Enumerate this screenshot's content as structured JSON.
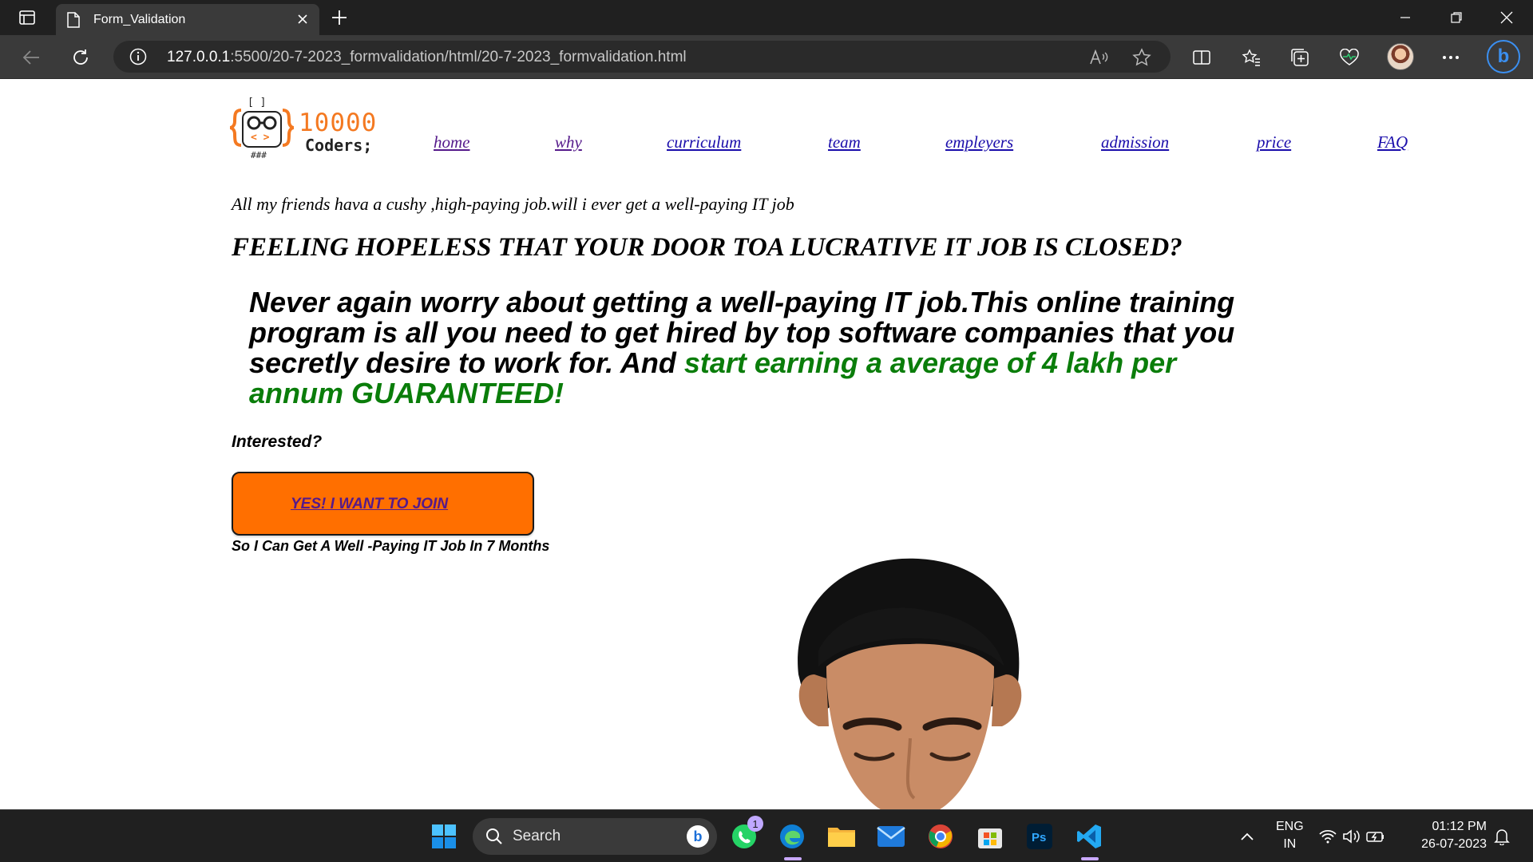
{
  "browser": {
    "tab_title": "Form_Validation",
    "url_host": "127.0.0.1",
    "url_path": ":5500/20-7-2023_formvalidation/html/20-7-2023_formvalidation.html"
  },
  "logo": {
    "number": "10000",
    "sub": "Coders;"
  },
  "nav": [
    "home",
    "why",
    "curriculum",
    "team",
    "empleyers",
    "admission",
    "price",
    "FAQ"
  ],
  "content": {
    "lede": "All my friends hava a cushy ,high-paying job.will i ever get a well-paying IT job",
    "headline": "FEELING HOPELESS THAT YOUR DOOR TOA LUCRATIVE IT JOB IS CLOSED?",
    "promo_main": "Never again worry about getting a well-paying IT job.This online training program is all you need to get hired by top software companies that you secretly desire to work for. And ",
    "promo_highlight": "start earning a average of 4 lakh per annum GUARANTEED!",
    "interested": "Interested?",
    "cta_label": "YES! I WANT TO JOIN",
    "cta_sub": "So I Can Get A Well -Paying IT Job In 7 Months"
  },
  "taskbar": {
    "search_label": "Search",
    "whatsapp_badge": "1",
    "ps_label": "Ps",
    "lang_line1": "ENG",
    "lang_line2": "IN",
    "time": "01:12 PM",
    "date": "26-07-2023"
  },
  "colors": {
    "accent_orange": "#ff6f00",
    "highlight_green": "#0a7d0a",
    "link_blue": "#1a0dab",
    "link_visited": "#551a8b"
  }
}
